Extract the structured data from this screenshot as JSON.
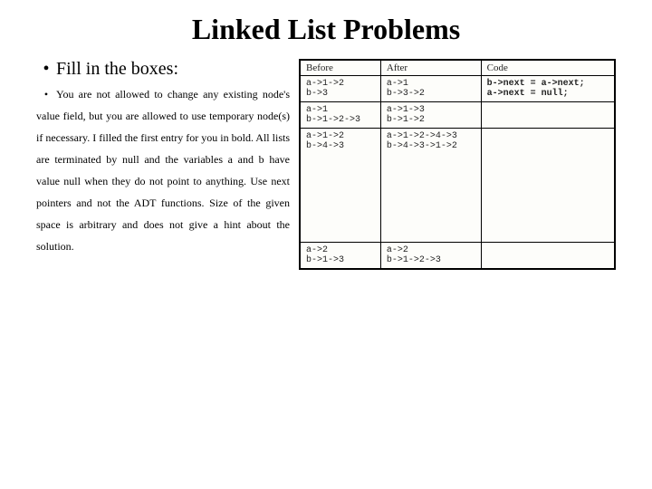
{
  "title": "Linked List Problems",
  "bullet_main": "Fill in the boxes:",
  "instruction": "You are not allowed to change any existing node's value field, but you are allowed to use temporary node(s) if necessary. I filled the first entry for you in bold. All lists are terminated by null and the variables a and b have value null when they do not point to anything. Use next pointers and not the ADT functions. Size of the given space is arbitrary and does not give a hint about the solution.",
  "table": {
    "headers": [
      "Before",
      "After",
      "Code"
    ],
    "rows": [
      {
        "before": "a->1->2\nb->3",
        "after": "a->1\nb->3->2",
        "code": "b->next = a->next;\na->next = null;",
        "code_bold": true
      },
      {
        "before": "a->1\nb->1->2->3",
        "after": "a->1->3\nb->1->2",
        "code": ""
      },
      {
        "before": "a->1->2\nb->4->3",
        "after": "a->1->2->4->3\nb->4->3->1->2",
        "code": "",
        "tall": true
      },
      {
        "before": "a->2\nb->1->3",
        "after": "a->2\nb->1->2->3",
        "code": ""
      }
    ]
  }
}
